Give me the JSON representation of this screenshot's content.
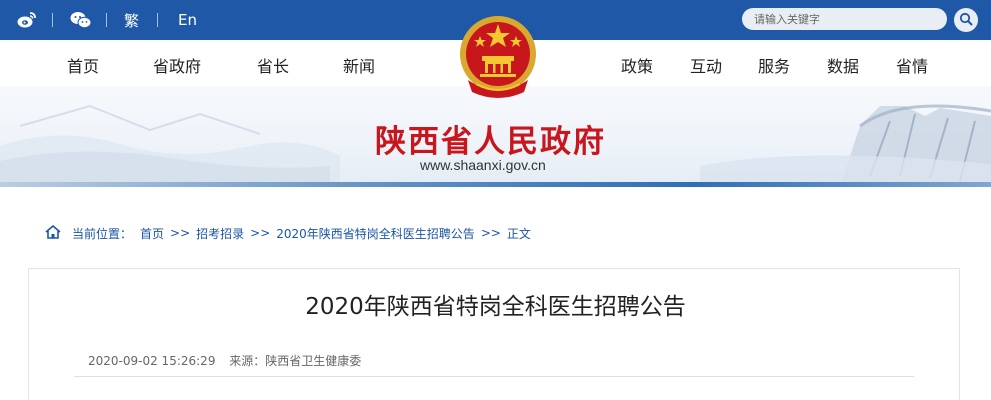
{
  "topbar": {
    "weibo_icon": "weibo-icon",
    "wechat_icon": "wechat-icon",
    "traditional_label": "繁",
    "english_label": "En",
    "search_placeholder": "请输入关键字",
    "search_icon": "search-icon",
    "bg_color": "#1e58a6"
  },
  "nav": {
    "items": [
      "首页",
      "省政府",
      "省长",
      "新闻",
      "政策",
      "互动",
      "服务",
      "数据",
      "省情"
    ]
  },
  "banner": {
    "site_name": "陕西省人民政府",
    "site_url": "www.shaanxi.gov.cn",
    "title_color": "#c8161d"
  },
  "breadcrumb": {
    "label": "当前位置：",
    "items": [
      "首页",
      "招考招录",
      "2020年陕西省特岗全科医生招聘公告",
      "正文"
    ],
    "separator": ">>"
  },
  "article": {
    "title": "2020年陕西省特岗全科医生招聘公告",
    "date": "2020-09-02 15:26:29",
    "source": "来源：陕西省卫生健康委"
  }
}
